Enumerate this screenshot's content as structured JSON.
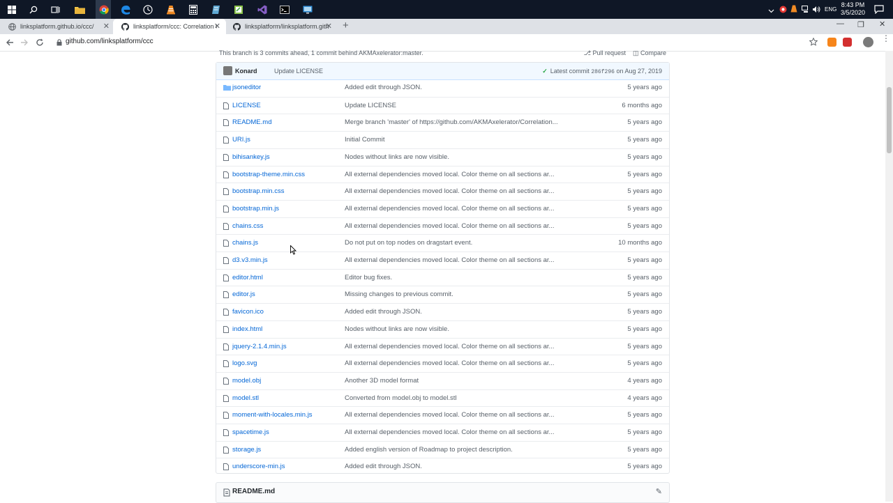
{
  "taskbar": {
    "icons": [
      "windows-start-icon",
      "search-icon",
      "task-view-icon",
      "file-explorer-icon",
      "chrome-icon",
      "edge-icon",
      "clock-app-icon",
      "vlc-icon",
      "calculator-icon",
      "notepad-icon",
      "notepad-plus-icon",
      "visual-studio-icon",
      "terminal-icon",
      "remote-desktop-icon"
    ],
    "tray": {
      "language": "ENG",
      "time": "8:43 PM",
      "date": "3/5/2020"
    }
  },
  "browser": {
    "tabs": [
      {
        "title": "linksplatform.github.io/ccc/",
        "active": false
      },
      {
        "title": "linksplatform/ccc: Correlation Ce",
        "active": true
      },
      {
        "title": "linksplatform/linksplatform.githu",
        "active": false
      }
    ],
    "url": "github.com/linksplatform/ccc"
  },
  "repo": {
    "branch_status": "This branch is 3 commits ahead, 1 commit behind AKMAxelerator:master.",
    "pull_request_label": "Pull request",
    "compare_label": "Compare",
    "commit": {
      "author": "Konard",
      "message": "Update LICENSE",
      "latest_label": "Latest commit",
      "sha": "286f296",
      "date": "on Aug 27, 2019"
    },
    "files": [
      {
        "name": "jsoneditor",
        "type": "dir",
        "message": "Added edit through JSON.",
        "age": "5 years ago"
      },
      {
        "name": "LICENSE",
        "type": "file",
        "message": "Update LICENSE",
        "age": "6 months ago"
      },
      {
        "name": "README.md",
        "type": "file",
        "message": "Merge branch 'master' of https://github.com/AKMAxelerator/Correlation...",
        "age": "5 years ago"
      },
      {
        "name": "URI.js",
        "type": "file",
        "message": "Initial Commit",
        "age": "5 years ago"
      },
      {
        "name": "bihisankey.js",
        "type": "file",
        "message": "Nodes without links are now visible.",
        "age": "5 years ago"
      },
      {
        "name": "bootstrap-theme.min.css",
        "type": "file",
        "message": "All external dependencies moved local. Color theme on all sections ar...",
        "age": "5 years ago"
      },
      {
        "name": "bootstrap.min.css",
        "type": "file",
        "message": "All external dependencies moved local. Color theme on all sections ar...",
        "age": "5 years ago"
      },
      {
        "name": "bootstrap.min.js",
        "type": "file",
        "message": "All external dependencies moved local. Color theme on all sections ar...",
        "age": "5 years ago"
      },
      {
        "name": "chains.css",
        "type": "file",
        "message": "All external dependencies moved local. Color theme on all sections ar...",
        "age": "5 years ago"
      },
      {
        "name": "chains.js",
        "type": "file",
        "message": "Do not put on top nodes on dragstart event.",
        "age": "10 months ago"
      },
      {
        "name": "d3.v3.min.js",
        "type": "file",
        "message": "All external dependencies moved local. Color theme on all sections ar...",
        "age": "5 years ago"
      },
      {
        "name": "editor.html",
        "type": "file",
        "message": "Editor bug fixes.",
        "age": "5 years ago"
      },
      {
        "name": "editor.js",
        "type": "file",
        "message": "Missing changes to previous commit.",
        "age": "5 years ago"
      },
      {
        "name": "favicon.ico",
        "type": "file",
        "message": "Added edit through JSON.",
        "age": "5 years ago"
      },
      {
        "name": "index.html",
        "type": "file",
        "message": "Nodes without links are now visible.",
        "age": "5 years ago"
      },
      {
        "name": "jquery-2.1.4.min.js",
        "type": "file",
        "message": "All external dependencies moved local. Color theme on all sections ar...",
        "age": "5 years ago"
      },
      {
        "name": "logo.svg",
        "type": "file",
        "message": "All external dependencies moved local. Color theme on all sections ar...",
        "age": "5 years ago"
      },
      {
        "name": "model.obj",
        "type": "file",
        "message": "Another 3D model format",
        "age": "4 years ago"
      },
      {
        "name": "model.stl",
        "type": "file",
        "message": "Converted from model.obj to model.stl",
        "age": "4 years ago"
      },
      {
        "name": "moment-with-locales.min.js",
        "type": "file",
        "message": "All external dependencies moved local. Color theme on all sections ar...",
        "age": "5 years ago"
      },
      {
        "name": "spacetime.js",
        "type": "file",
        "message": "All external dependencies moved local. Color theme on all sections ar...",
        "age": "5 years ago"
      },
      {
        "name": "storage.js",
        "type": "file",
        "message": "Added english version of Roadmap to project description.",
        "age": "5 years ago"
      },
      {
        "name": "underscore-min.js",
        "type": "file",
        "message": "Added edit through JSON.",
        "age": "5 years ago"
      }
    ],
    "readme_title": "README.md"
  },
  "colors": {
    "link": "#0366d6",
    "muted": "#586069",
    "commit_bg": "#f1f8ff",
    "check": "#28a745",
    "folder": "#79b8ff"
  }
}
